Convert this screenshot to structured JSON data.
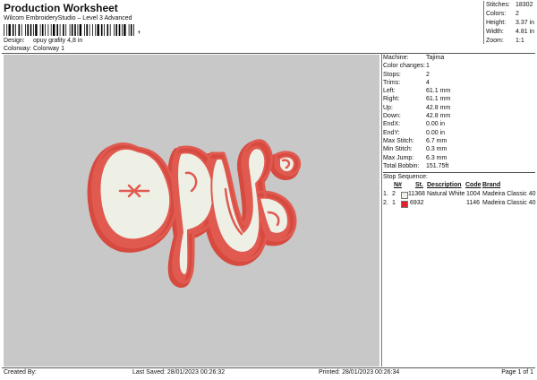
{
  "header": {
    "title": "Production Worksheet",
    "subtitle": "Wilcom EmbroideryStudio – Level 3 Advanced",
    "barcode_suffix": ","
  },
  "design_info": {
    "design_label": "Design:",
    "design_value": "opuy grafity 4,8 in",
    "colorway_label": "Colorway:",
    "colorway_value": "Colorway 1"
  },
  "summary": [
    {
      "label": "Stitches:",
      "value": "18302"
    },
    {
      "label": "Colors:",
      "value": "2"
    },
    {
      "label": "Height:",
      "value": "3.37 in"
    },
    {
      "label": "Width:",
      "value": "4.81 in"
    },
    {
      "label": "Zoom:",
      "value": "1:1"
    }
  ],
  "details": [
    {
      "label": "Machine:",
      "value": "Tajima"
    },
    {
      "label": "Color changes:",
      "value": "1"
    },
    {
      "label": "Stops:",
      "value": "2"
    },
    {
      "label": "Trims:",
      "value": "4"
    },
    {
      "label": "Left:",
      "value": "61.1 mm"
    },
    {
      "label": "Right:",
      "value": "61.1 mm"
    },
    {
      "label": "Up:",
      "value": "42.8 mm"
    },
    {
      "label": "Down:",
      "value": "42.8 mm"
    },
    {
      "label": "EndX:",
      "value": "0.00 in"
    },
    {
      "label": "EndY:",
      "value": "0.00 in"
    },
    {
      "label": "Max Stitch:",
      "value": "6.7 mm"
    },
    {
      "label": "Min Stitch:",
      "value": "0.3 mm"
    },
    {
      "label": "Max Jump:",
      "value": "6.3 mm"
    },
    {
      "label": "Total Bobbin:",
      "value": "151.75ft"
    }
  ],
  "stop_sequence": {
    "title": "Stop Sequence:",
    "headers": {
      "num": "N#",
      "st": "St.",
      "description": "Description",
      "code": "Code",
      "brand": "Brand"
    },
    "rows": [
      {
        "index": "1.",
        "num": "2",
        "color": "#f1f1e8",
        "st": "11368",
        "description": "Natural White",
        "code": "1004",
        "brand": "Madeira Classic 40"
      },
      {
        "index": "2.",
        "num": "1",
        "color": "#e0202a",
        "st": "6932",
        "description": "",
        "code": "1146",
        "brand": "Madeira Classic 40"
      }
    ]
  },
  "footer": {
    "created_by": "Created By:",
    "last_saved": "Last Saved: 28/01/2023 00:26:32",
    "printed": "Printed: 28/01/2023 00:26:34",
    "page": "Page 1 of 1"
  },
  "colors": {
    "thread_red": "#e05a50",
    "thread_white": "#eef0e6",
    "canvas_bg": "#c8c8c8"
  }
}
